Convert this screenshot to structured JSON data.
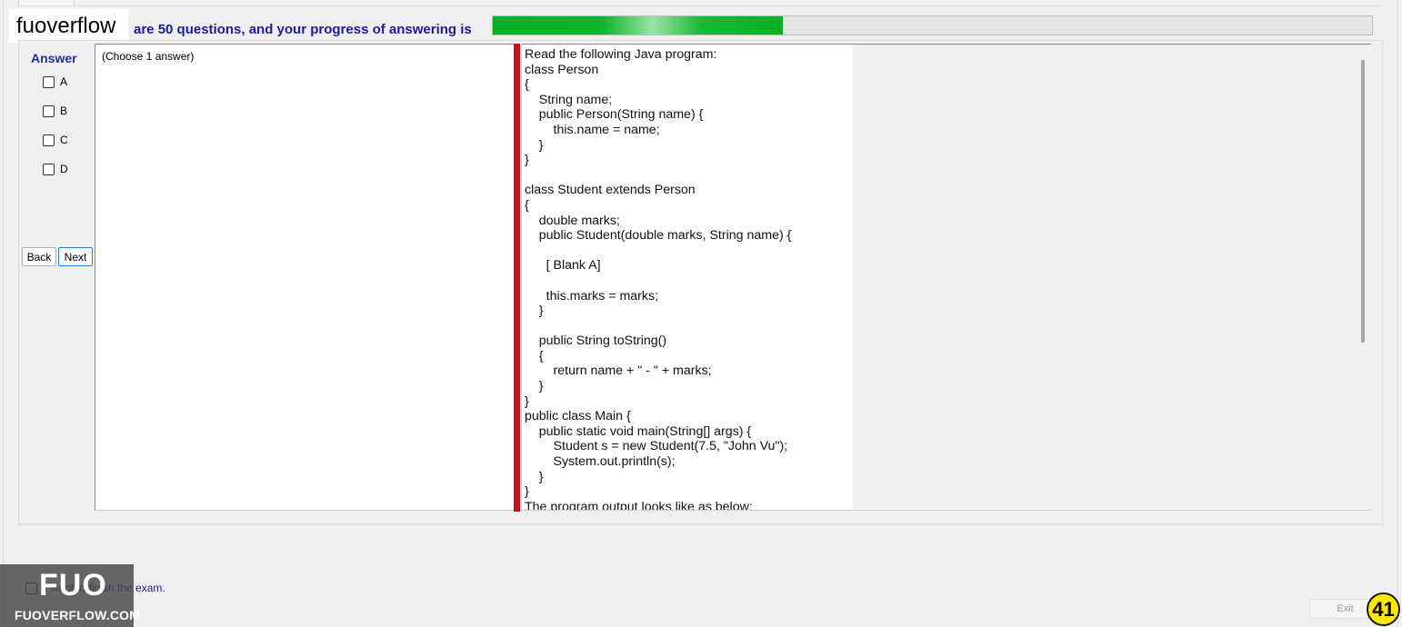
{
  "brand": {
    "logo_text": "fuoverflow"
  },
  "header": {
    "progress_text": "are 50 questions, and your progress of answering is",
    "progress_fraction": 0.33,
    "progress_color": "#06b025"
  },
  "answer_panel": {
    "title": "Answer",
    "options": [
      "A",
      "B",
      "C",
      "D"
    ],
    "back_label": "Back",
    "next_label": "Next"
  },
  "left_pane": {
    "choose_text": "(Choose 1 answer)"
  },
  "question": {
    "text": "Read the following Java program:\nclass Person\n{\n    String name;\n    public Person(String name) {\n        this.name = name;\n    }\n}\n\nclass Student extends Person\n{\n    double marks;\n    public Student(double marks, String name) {\n\n      [ Blank A]\n\n      this.marks = marks;\n    }\n\n    public String toString()\n    {\n        return name + \" - \" + marks;\n    }\n}\npublic class Main {\n    public static void main(String[] args) {\n        Student s = new Student(7.5, \"John Vu\");\n        System.out.println(s);\n    }\n}\nThe program output looks like as below:"
  },
  "footer": {
    "finish_label": "I want to finish the exam.",
    "exit_label": "Exit",
    "page_badge": "41"
  },
  "watermark": {
    "big": "FUO",
    "small": "FUOVERFLOW.COM"
  },
  "colors": {
    "splitter": "#c8101a",
    "badge": "#ffe800",
    "title_blue": "#1e2fa0"
  }
}
